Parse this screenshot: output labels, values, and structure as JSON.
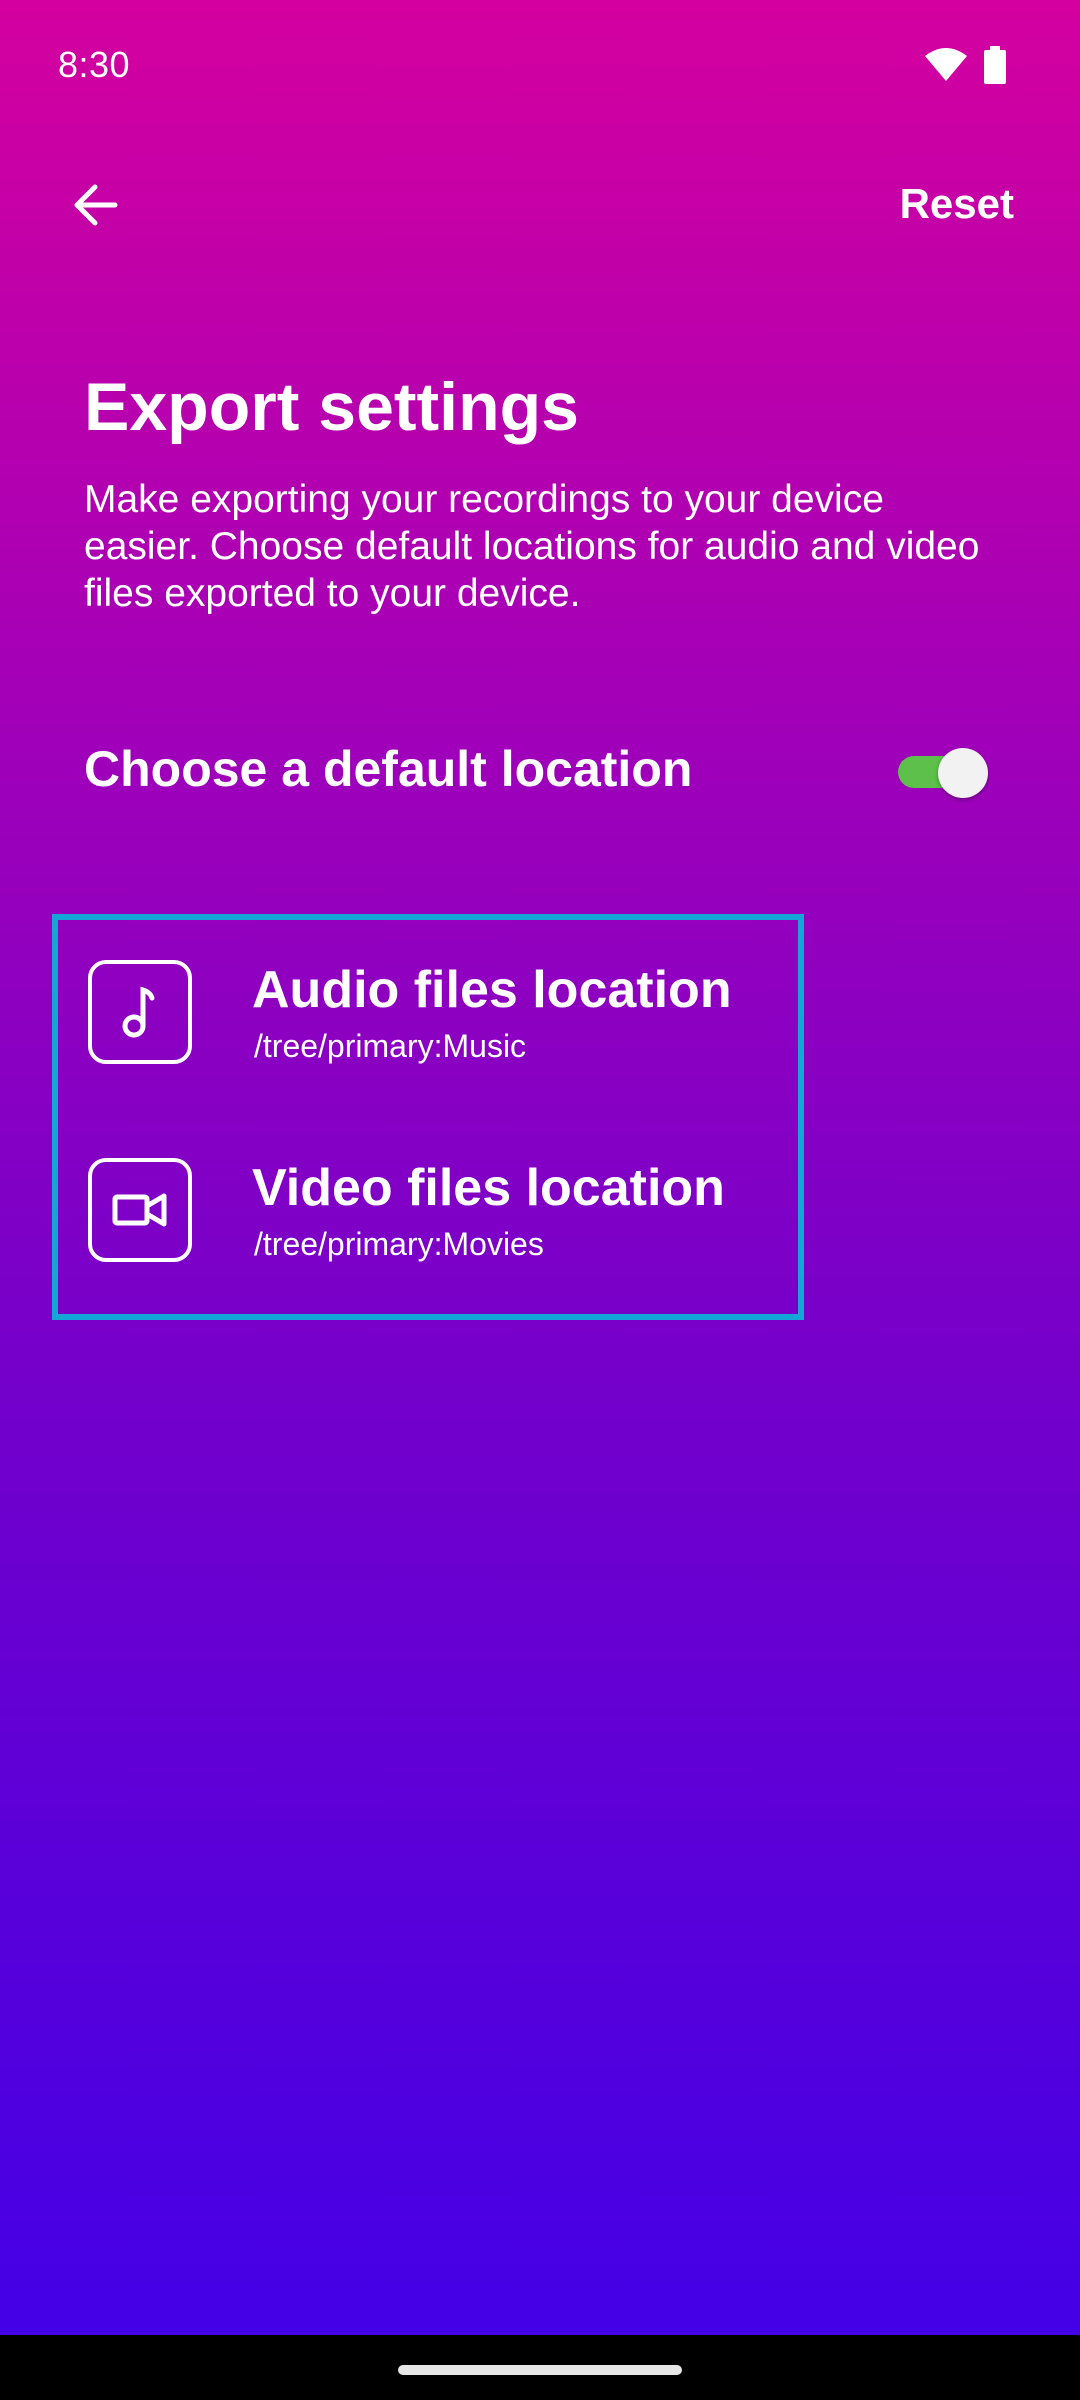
{
  "status_bar": {
    "time": "8:30",
    "icons": [
      "wifi-icon",
      "battery-icon"
    ]
  },
  "top_bar": {
    "back_icon": "arrow-back-icon",
    "reset_label": "Reset"
  },
  "page": {
    "title": "Export settings",
    "description": "Make exporting your recordings to your device easier. Choose default locations for audio and video files exported to your device."
  },
  "default_location": {
    "label": "Choose a default location",
    "enabled": true
  },
  "locations": [
    {
      "icon": "music-note-icon",
      "title": "Audio files location",
      "path": "/tree/primary:Music"
    },
    {
      "icon": "video-camera-icon",
      "title": "Video files location",
      "path": "/tree/primary:Movies"
    }
  ],
  "colors": {
    "gradient_top": "#d4009f",
    "gradient_bottom": "#4400e6",
    "toggle_on": "#5cc04a",
    "highlight_border": "#14a6d6"
  }
}
